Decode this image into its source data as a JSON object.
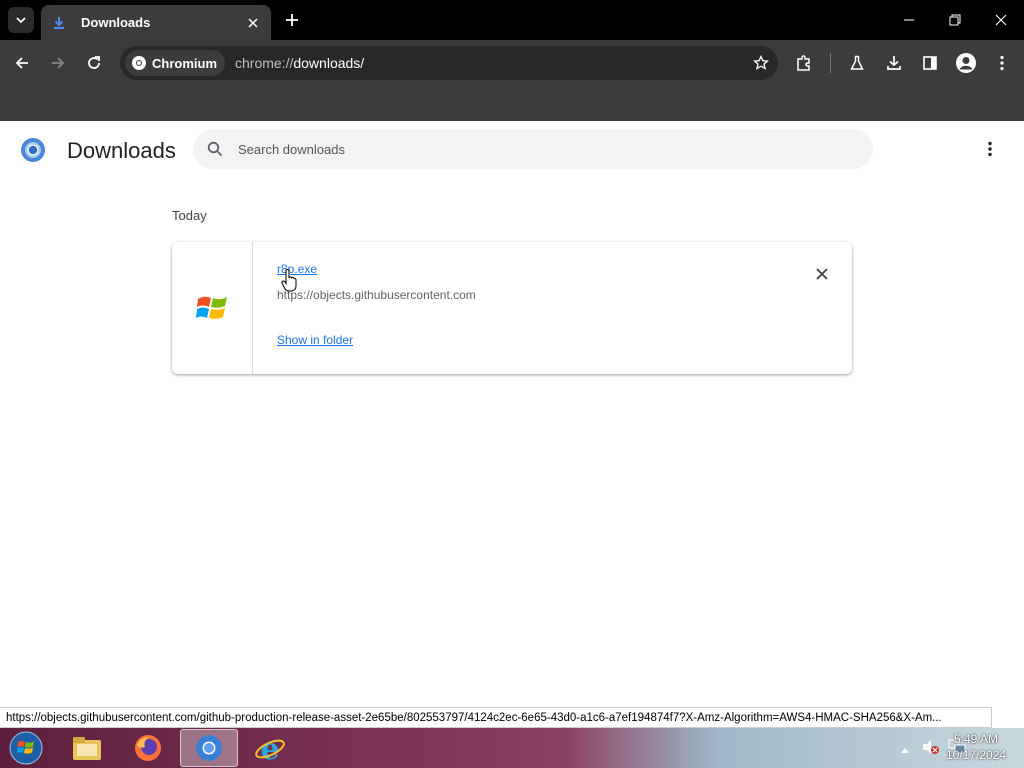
{
  "window": {
    "tab_title": "Downloads",
    "site_chip_label": "Chromium",
    "url_scheme": "chrome://",
    "url_path": "downloads/"
  },
  "page": {
    "title": "Downloads",
    "search_placeholder": "Search downloads",
    "section_date": "Today",
    "downloads": [
      {
        "file_name": "r8p.exe",
        "source_url": "https://objects.githubusercontent.com",
        "action_label": "Show in folder"
      }
    ]
  },
  "status_bar": {
    "link_url": "https://objects.githubusercontent.com/github-production-release-asset-2e65be/802553797/4124c2ec-6e65-43d0-a1c6-a7ef194874f7?X-Amz-Algorithm=AWS4-HMAC-SHA256&X-Am..."
  },
  "taskbar": {
    "apps": [
      "start-icon",
      "file-explorer-icon",
      "firefox-icon",
      "chromium-icon",
      "internet-explorer-icon"
    ],
    "time": "5:49 AM",
    "date": "10/17/2024"
  },
  "colors": {
    "link_blue": "#1a73e8",
    "toolbar_bg": "#3c3c3c",
    "titlebar_bg": "#000000"
  }
}
